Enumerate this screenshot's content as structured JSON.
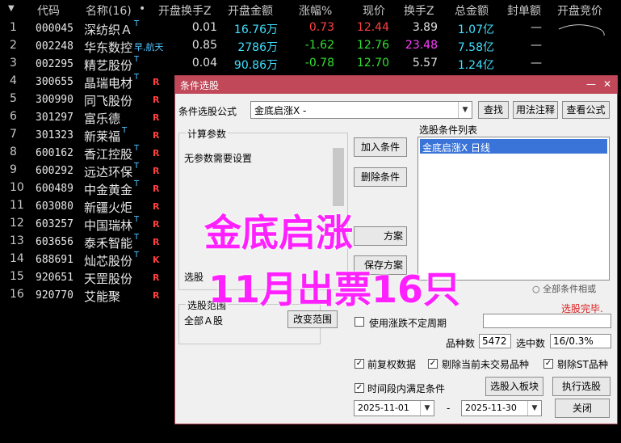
{
  "header": {
    "code": "代码",
    "name": "名称(16)",
    "dot": "•",
    "open_turnover": "开盘换手Z",
    "open_amount": "开盘金额",
    "change": "涨幅%",
    "price": "现价",
    "turnover": "换手Z",
    "market_cap": "总金额",
    "seal_amount": "封单额",
    "open_bid": "开盘竞价"
  },
  "rows": [
    {
      "idx": "1",
      "code": "000045",
      "name": "深纺织Ａ",
      "mark": "T",
      "r": "",
      "open_turnover": "0.01",
      "open_amount": "16.76万",
      "change": "0.73",
      "price": "12.44",
      "turnover": "3.89",
      "cap": "1.07亿",
      "seal": "—",
      "chg_color": "red",
      "hs_color": "",
      "extra": ""
    },
    {
      "idx": "2",
      "code": "002248",
      "name": "华东数控",
      "mark": "",
      "r": "",
      "open_turnover": "0.85",
      "open_amount": "2786万",
      "change": "-1.62",
      "price": "12.76",
      "turnover": "23.48",
      "cap": "7.58亿",
      "seal": "—",
      "chg_color": "green",
      "hs_color": "magenta",
      "extra": "早,航天"
    },
    {
      "idx": "3",
      "code": "002295",
      "name": "精艺股份",
      "mark": "T",
      "r": "",
      "open_turnover": "0.04",
      "open_amount": "90.86万",
      "change": "-0.78",
      "price": "12.70",
      "turnover": "5.57",
      "cap": "1.24亿",
      "seal": "—",
      "chg_color": "green",
      "hs_color": "",
      "extra": ""
    },
    {
      "idx": "4",
      "code": "300655",
      "name": "晶瑞电材",
      "mark": "T",
      "r": "R",
      "extra": ""
    },
    {
      "idx": "5",
      "code": "300990",
      "name": "同飞股份",
      "mark": "",
      "r": "R",
      "extra": ""
    },
    {
      "idx": "6",
      "code": "301297",
      "name": "富乐德",
      "mark": "",
      "r": "R",
      "extra": ""
    },
    {
      "idx": "7",
      "code": "301323",
      "name": "新莱福",
      "mark": "T",
      "r": "R",
      "extra": ""
    },
    {
      "idx": "8",
      "code": "600162",
      "name": "香江控股",
      "mark": "T",
      "r": "R",
      "extra": ""
    },
    {
      "idx": "9",
      "code": "600292",
      "name": "远达环保",
      "mark": "T",
      "r": "R",
      "extra": ""
    },
    {
      "idx": "10",
      "code": "600489",
      "name": "中金黄金",
      "mark": "T",
      "r": "R",
      "extra": ""
    },
    {
      "idx": "11",
      "code": "603080",
      "name": "新疆火炬",
      "mark": "",
      "r": "R",
      "extra": ""
    },
    {
      "idx": "12",
      "code": "603257",
      "name": "中国瑞林",
      "mark": "T",
      "r": "R",
      "extra": ""
    },
    {
      "idx": "13",
      "code": "603656",
      "name": "泰禾智能",
      "mark": "T",
      "r": "R",
      "extra": ""
    },
    {
      "idx": "14",
      "code": "688691",
      "name": "灿芯股份",
      "mark": "T",
      "r": "K",
      "extra": ""
    },
    {
      "idx": "15",
      "code": "920651",
      "name": "天罡股份",
      "mark": "",
      "r": "R",
      "extra": ""
    },
    {
      "idx": "16",
      "code": "920770",
      "name": "艾能聚",
      "mark": "",
      "r": "R",
      "extra": ""
    }
  ],
  "dialog": {
    "title": "条件选股",
    "formula_label": "条件选股公式",
    "formula_value": "金底启涨X  -",
    "btn_find": "查找",
    "btn_usage": "用法注释",
    "btn_view": "查看公式",
    "params_group": "计算参数",
    "params_text": "无参数需要设置",
    "list_label": "选股条件列表",
    "list_item": "金底启涨X  日线",
    "btn_add": "加入条件",
    "btn_delete": "删除条件",
    "btn_scheme_load_partial": "方案",
    "btn_scheme_save_partial": "保存方案",
    "select_partial": "选股",
    "radio_all": "全部条件相或",
    "status": "选股完毕.",
    "range_group": "选股范围",
    "range_value": "全部Ａ股",
    "btn_range": "改变范围",
    "chk_uncertain": "使用涨跌不定周期",
    "count_label": "品种数",
    "count_value": "5472",
    "selected_label": "选中数",
    "selected_value": "16/0.3%",
    "chk_fq": "前复权数据",
    "chk_exclude_untraded": "剔除当前未交易品种",
    "chk_exclude_st": "剔除ST品种",
    "chk_period": "时间段内满足条件",
    "btn_to_board": "选股入板块",
    "btn_run": "执行选股",
    "date_from": "2025-11-01",
    "date_dash": "-",
    "date_to": "2025-11-30",
    "btn_close": "关闭"
  },
  "overlay": {
    "line1": "金底启涨",
    "line2": "11月出票16只"
  },
  "colors": {
    "title_bar": "#c04858",
    "overlay": "#ff20ff",
    "up": "#ff4040",
    "down": "#30e030"
  }
}
